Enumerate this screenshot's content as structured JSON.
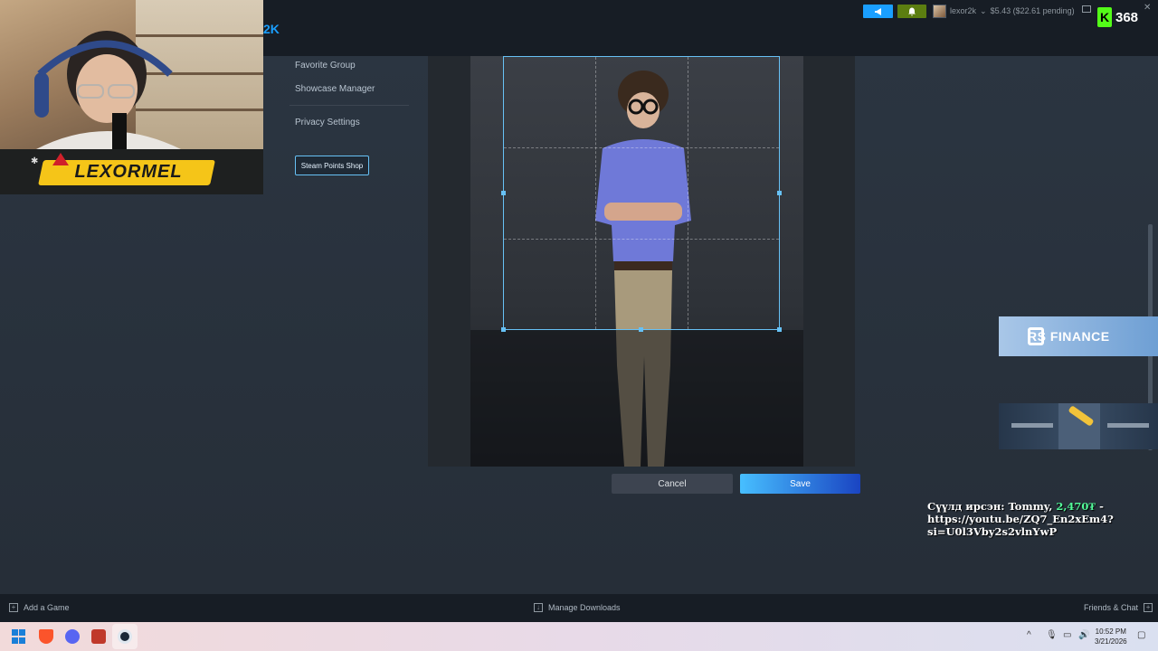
{
  "topbar": {
    "brand_tail": "2K",
    "user_label": "lexor2k",
    "wallet": "$5.43 ($22.61 pending)",
    "kick_count": "368"
  },
  "sidebar": {
    "items": [
      "Favorite Group",
      "Showcase Manager",
      "Privacy Settings"
    ],
    "points_button": "Steam Points Shop"
  },
  "editor": {
    "cancel_label": "Cancel",
    "save_label": "Save"
  },
  "stream": {
    "streamer_name": "LEXORMEL",
    "sponsor": "RS FINANCE",
    "donation_prefix": "Сүүлд ирсэн: Tommy, ",
    "donation_amount": "2,470₮",
    "donation_suffix": " - https://youtu.be/ZQ7_En2xEm4?si=U0l3Vby2s2vlnYwP"
  },
  "bottombar": {
    "add_game": "Add a Game",
    "manage_downloads": "Manage Downloads",
    "friends_chat": "Friends & Chat"
  },
  "taskbar": {
    "time": "10:52 PM",
    "date": "3/21/2026"
  },
  "colors": {
    "steam_blue": "#1a9fff",
    "save_gradient_start": "#47bfff",
    "kick_green": "#53fc18"
  }
}
